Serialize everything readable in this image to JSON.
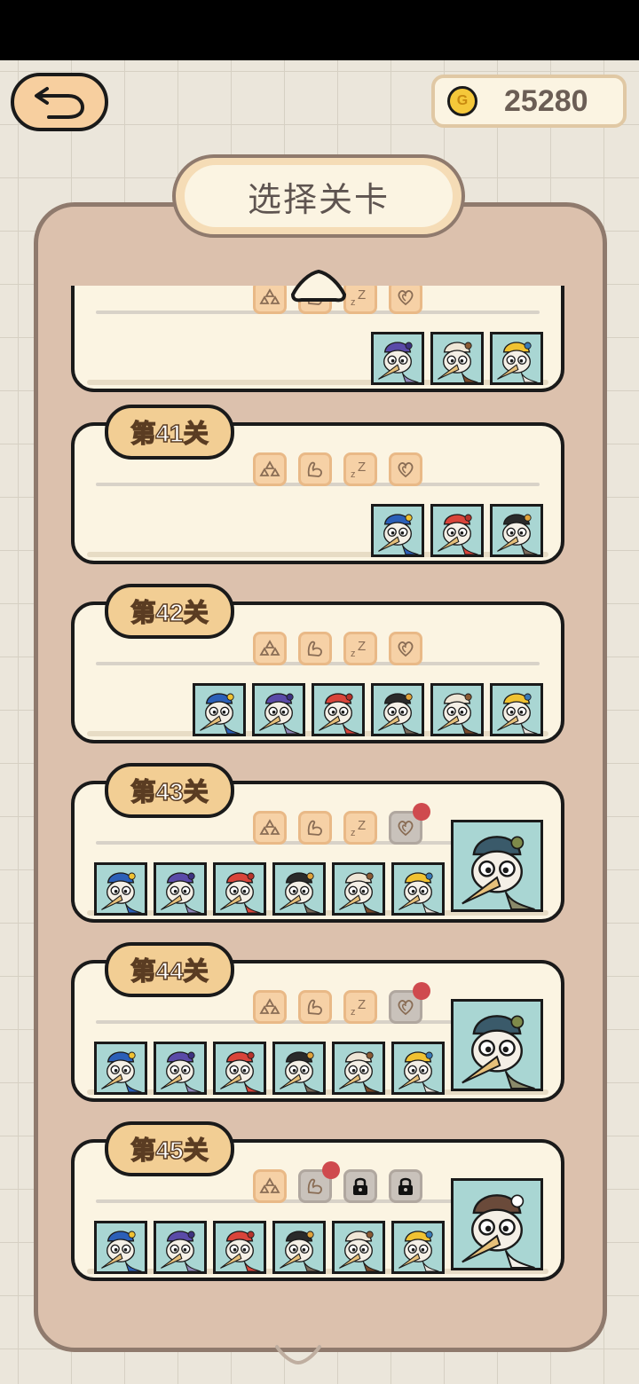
{
  "header": {
    "back_label": "",
    "coins": "25280",
    "coin_symbol": "G"
  },
  "title": "选择关卡",
  "levels": [
    {
      "name": "",
      "partial": true,
      "tags": [
        "triangles",
        "muscle",
        "sleep",
        "heart"
      ],
      "enemies": [
        "wizard",
        "feather-chief",
        "turban-elder"
      ],
      "boss": null
    },
    {
      "name": "第41关",
      "tags": [
        "triangles",
        "muscle",
        "sleep",
        "heart"
      ],
      "enemies": [
        "jester",
        "red-rooster",
        "fedora-bird"
      ],
      "boss": null
    },
    {
      "name": "第42关",
      "tags": [
        "triangles",
        "muscle",
        "sleep",
        "heart"
      ],
      "enemies": [
        "jester",
        "wizard",
        "red-rooster",
        "fedora-bird",
        "feather-chief",
        "turban-elder"
      ],
      "boss": null
    },
    {
      "name": "第43关",
      "tags": [
        "triangles",
        "muscle",
        "sleep",
        "heart"
      ],
      "alert_tag": 3,
      "enemies": [
        "jester",
        "wizard",
        "red-rooster",
        "fedora-bird",
        "feather-chief",
        "turban-elder"
      ],
      "boss": "medusa-bird"
    },
    {
      "name": "第44关",
      "tags": [
        "triangles",
        "muscle",
        "sleep",
        "heart"
      ],
      "alert_tag": 3,
      "enemies": [
        "jester",
        "wizard",
        "red-rooster",
        "fedora-bird",
        "feather-chief",
        "turban-elder"
      ],
      "boss": "medusa-bird"
    },
    {
      "name": "第45关",
      "tags": [
        "triangles",
        "muscle",
        "lock",
        "lock"
      ],
      "alert_tag": 1,
      "enemies": [
        "jester",
        "wizard",
        "red-rooster",
        "fedora-bird",
        "feather-chief",
        "turban-elder"
      ],
      "boss": "professor-bird"
    }
  ],
  "colors": {
    "card_bg": "#fbf4e2",
    "panel_bg": "#dcc1ad",
    "badge_bg": "#f2ce94",
    "tag_bg": "#f6d1a6",
    "alert_dot": "#cf4a4e",
    "portrait_bg": "#a9d6d3"
  }
}
